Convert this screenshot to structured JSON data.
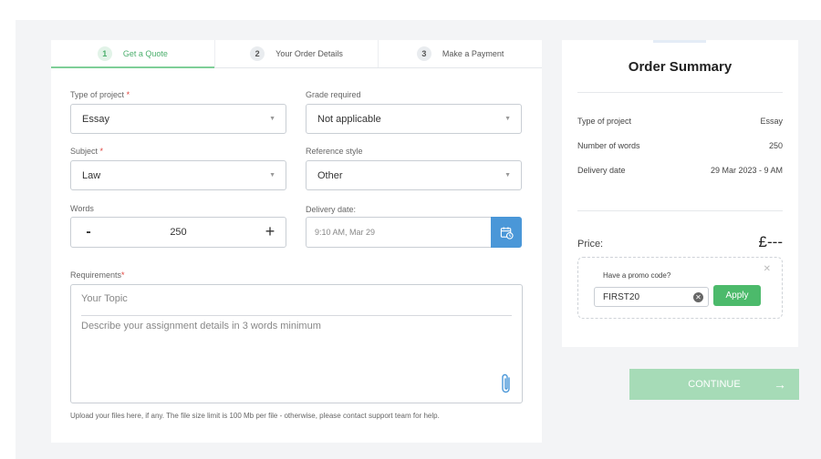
{
  "steps": [
    {
      "num": "1",
      "label": "Get a Quote"
    },
    {
      "num": "2",
      "label": "Your Order Details"
    },
    {
      "num": "3",
      "label": "Make a Payment"
    }
  ],
  "form": {
    "project_type": {
      "label": "Type of project",
      "req": "*",
      "value": "Essay"
    },
    "grade": {
      "label": "Grade required",
      "value": "Not applicable"
    },
    "subject": {
      "label": "Subject",
      "req": "*",
      "value": "Law"
    },
    "reference": {
      "label": "Reference style",
      "value": "Other"
    },
    "words": {
      "label": "Words",
      "value": "250",
      "minus": "-",
      "plus": "+"
    },
    "delivery": {
      "label": "Delivery date:",
      "value": "9:10 AM, Mar 29"
    },
    "requirements": {
      "label": "Requirements",
      "req": "*",
      "topic_placeholder": "Your Topic",
      "details_placeholder": "Describe your assignment details in 3 words minimum"
    },
    "upload_note": "Upload your files here, if any. The file size limit is 100 Mb per file - otherwise, please contact support team for help."
  },
  "summary": {
    "title": "Order Summary",
    "rows": [
      {
        "label": "Type of project",
        "value": "Essay"
      },
      {
        "label": "Number of words",
        "value": "250"
      },
      {
        "label": "Delivery date",
        "value": "29 Mar 2023 - 9 AM"
      }
    ],
    "price_label": "Price:",
    "price_value": "£---",
    "promo": {
      "title": "Have a promo code?",
      "code": "FIRST20",
      "apply_label": "Apply",
      "close": "✕",
      "clear": "✕"
    }
  },
  "continue_label": "CONTINUE",
  "continue_arrow": "→",
  "colors": {
    "accent_green": "#4cba6b",
    "continue_bg": "#a6dbb7",
    "calendar_blue": "#4a97d8",
    "required_red": "#e0413b"
  }
}
